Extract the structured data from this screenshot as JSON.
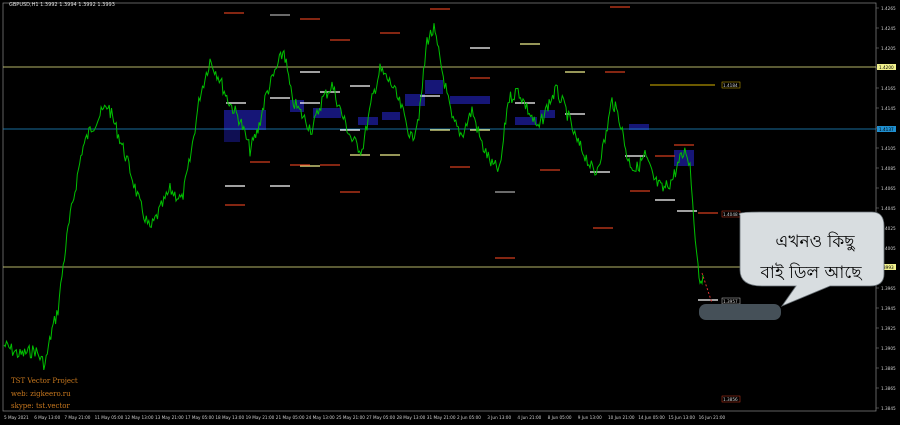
{
  "header": {
    "symbol_info": "GBPUSD,H1  1.3992 1.3994 1.3992 1.3993"
  },
  "watermark": {
    "line1": "TST Vector Project",
    "line2": "web: zigkeero.ru",
    "line3": "skype: tst.vector"
  },
  "callout": {
    "line1": "এখনও কিছু",
    "line2": "বাই ডিল আছে"
  },
  "price_axis": [
    "1.4265",
    "1.4245",
    "1.4205",
    "1.4185",
    "1.4165",
    "1.4145",
    "1.4125",
    "1.4105",
    "1.4085",
    "1.4065",
    "1.4045",
    "1.4025",
    "1.4005",
    "1.3985",
    "1.3965",
    "1.3945",
    "1.3925",
    "1.3905",
    "1.3885",
    "1.3865",
    "1.3845"
  ],
  "price_tags": {
    "top_line": "1.4200",
    "blue_line": "1.4137",
    "level_4184": "1.4184",
    "level_4048": "1.4048",
    "current": "1.3993",
    "level_3957": "1.3957",
    "level_3856": "1.3856"
  },
  "time_axis": [
    "5 May 2021",
    "6 May 13:00",
    "7 May 21:00",
    "11 May 05:00",
    "12 May 13:00",
    "13 May 21:00",
    "17 May 05:00",
    "18 May 13:00",
    "19 May 21:00",
    "21 May 05:00",
    "24 May 13:00",
    "25 May 21:00",
    "27 May 05:00",
    "28 May 13:00",
    "31 May 21:00",
    "2 Jun 05:00",
    "3 Jun 13:00",
    "4 Jun 21:00",
    "8 Jun 05:00",
    "9 Jun 13:00",
    "10 Jun 21:00",
    "14 Jun 05:00",
    "15 Jun 13:00",
    "16 Jun 21:00"
  ],
  "colors": {
    "background": "#000000",
    "candles": "#00c000",
    "zones": "#1a1a8c",
    "support_line": "#f0f08c",
    "pivot_line": "#1f8fd0",
    "resistance_ticks": "#d23c1e",
    "callout_bubble": "#d8dde0"
  }
}
